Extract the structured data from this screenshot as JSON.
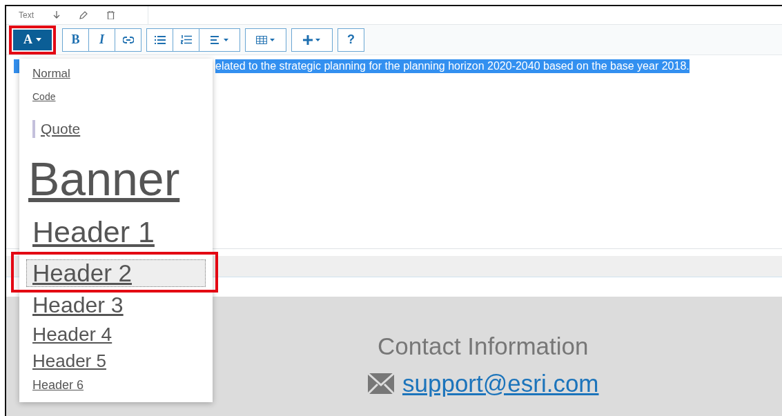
{
  "tab_strip": {
    "label": "Text"
  },
  "toolbar": {
    "groups": [
      {
        "buttons": [
          {
            "kind": "format",
            "label": "A",
            "selected": true,
            "annotated": true
          }
        ]
      },
      {
        "buttons": [
          {
            "kind": "bold",
            "label": "B"
          },
          {
            "kind": "italic",
            "label": "I"
          },
          {
            "kind": "link"
          }
        ]
      },
      {
        "buttons": [
          {
            "kind": "bullets"
          },
          {
            "kind": "numbers"
          },
          {
            "kind": "align"
          }
        ]
      },
      {
        "buttons": [
          {
            "kind": "table"
          }
        ]
      },
      {
        "buttons": [
          {
            "kind": "insert"
          }
        ]
      },
      {
        "buttons": [
          {
            "kind": "help",
            "label": "?"
          }
        ]
      }
    ]
  },
  "editor": {
    "text": "elated to the strategic planning for the planning horizon 2020-2040 based on the base year 2018.",
    "selected": true
  },
  "format_menu": {
    "items": [
      {
        "kind": "normal",
        "label": "Normal",
        "selected": false,
        "annotated": false
      },
      {
        "kind": "code",
        "label": "Code",
        "selected": false,
        "annotated": false
      },
      {
        "kind": "quote",
        "label": "Quote",
        "selected": false,
        "annotated": false
      },
      {
        "kind": "banner",
        "label": "Banner",
        "selected": false,
        "annotated": false
      },
      {
        "kind": "h1",
        "label": "Header 1",
        "selected": false,
        "annotated": false
      },
      {
        "kind": "h2",
        "label": "Header 2",
        "selected": true,
        "annotated": true
      },
      {
        "kind": "h3",
        "label": "Header 3",
        "selected": false,
        "annotated": false
      },
      {
        "kind": "h4",
        "label": "Header 4",
        "selected": false,
        "annotated": false
      },
      {
        "kind": "h5",
        "label": "Header 5",
        "selected": false,
        "annotated": false
      },
      {
        "kind": "h6",
        "label": "Header 6",
        "selected": false,
        "annotated": false
      }
    ]
  },
  "footer": {
    "title": "Contact Information",
    "email": "support@esri.com"
  }
}
